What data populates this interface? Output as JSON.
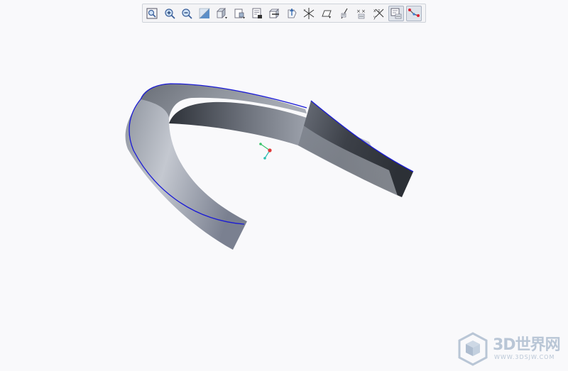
{
  "toolbar": {
    "buttons": [
      {
        "name": "refit-icon"
      },
      {
        "name": "zoom-in-icon"
      },
      {
        "name": "zoom-out-icon"
      },
      {
        "name": "reorient-icon"
      },
      {
        "name": "display-style-icon"
      },
      {
        "name": "saved-views-icon"
      },
      {
        "name": "view-manager-icon"
      },
      {
        "name": "section-view-icon"
      },
      {
        "name": "spin-center-icon"
      },
      {
        "name": "datum-planes-icon"
      },
      {
        "name": "datum-plane-display-icon"
      },
      {
        "name": "datum-axes-icon"
      },
      {
        "name": "datum-points-icon"
      },
      {
        "name": "coordinate-systems-icon"
      },
      {
        "name": "annotation-display-icon"
      },
      {
        "name": "model-tree-sketch-icon"
      }
    ],
    "active_buttons": [
      "annotation-display-icon",
      "model-tree-sketch-icon"
    ]
  },
  "model": {
    "shape": "curved sweep band",
    "colors": {
      "edge": "#1a1ad6",
      "dark": "#3d424a",
      "light": "#b7bcc6",
      "background": "#f9f9fb"
    }
  },
  "watermark": {
    "title": "3D世界网",
    "url": "WWW.3DSJW.COM",
    "color": "#b9c6d6"
  }
}
